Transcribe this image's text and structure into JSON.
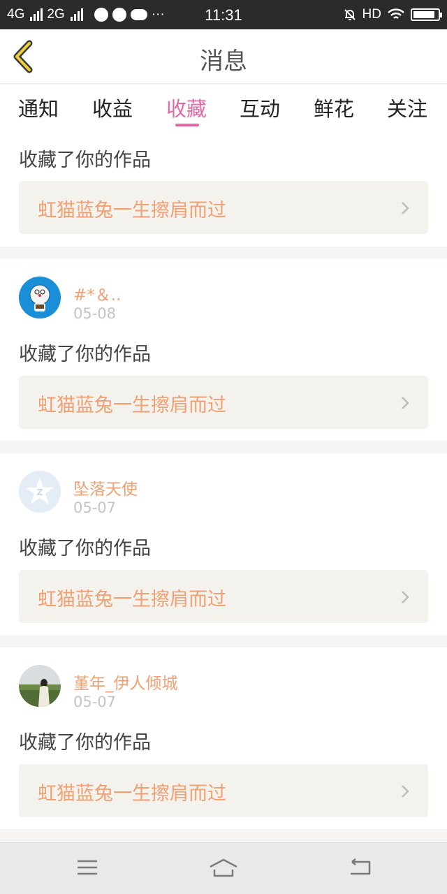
{
  "status_bar": {
    "network1": "4G",
    "network2": "2G",
    "more": "···",
    "time": "11:31",
    "hd": "HD"
  },
  "header": {
    "title": "消息"
  },
  "tabs": [
    {
      "label": "通知",
      "active": false
    },
    {
      "label": "收益",
      "active": false
    },
    {
      "label": "收藏",
      "active": true
    },
    {
      "label": "互动",
      "active": false
    },
    {
      "label": "鲜花",
      "active": false
    },
    {
      "label": "关注",
      "active": false
    }
  ],
  "messages": [
    {
      "user": "",
      "date": "",
      "action": "收藏了你的作品",
      "work": "虹猫蓝兔一生擦肩而过"
    },
    {
      "user": "#*＆..",
      "date": "05-08",
      "action": "收藏了你的作品",
      "work": "虹猫蓝兔一生擦肩而过"
    },
    {
      "user": "坠落天使",
      "date": "05-07",
      "action": "收藏了你的作品",
      "work": "虹猫蓝兔一生擦肩而过"
    },
    {
      "user": "堇年_伊人倾城",
      "date": "05-07",
      "action": "收藏了你的作品",
      "work": "虹猫蓝兔一生擦肩而过"
    }
  ],
  "colors": {
    "accent": "#e06aa6",
    "work_title": "#f0a072",
    "username": "#f0a072",
    "card_bg": "#f4f2ec"
  },
  "icons": [
    "back-icon",
    "chevron-right-icon",
    "menu-icon",
    "home-icon",
    "return-icon"
  ]
}
